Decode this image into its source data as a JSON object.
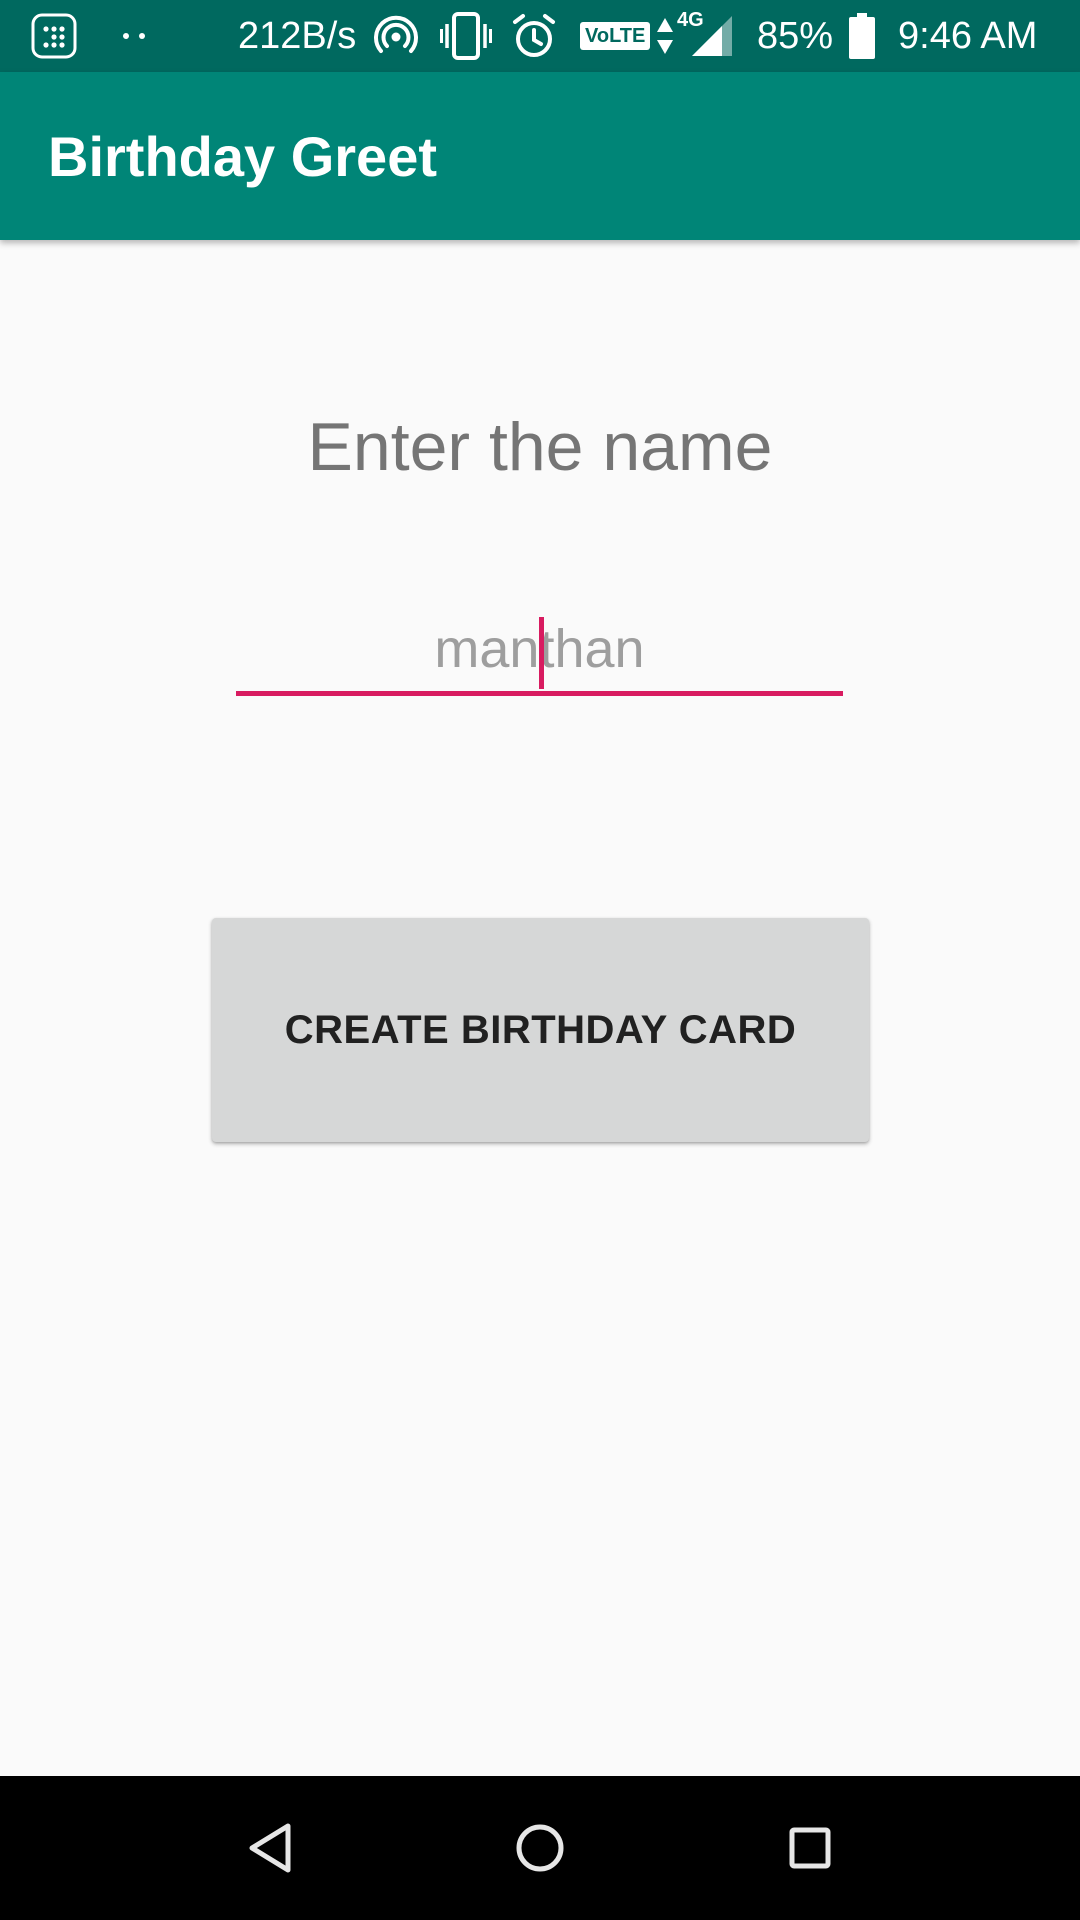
{
  "status_bar": {
    "data_rate": "212B/s",
    "network_label": "VoLTE",
    "network_type": "4G",
    "battery_percent": "85%",
    "time": "9:46 AM",
    "icons": [
      "keypad-notification-icon",
      "more-notifications-dots-icon",
      "hotspot-icon",
      "vibrate-icon",
      "alarm-icon",
      "volte-icon",
      "signal-icon",
      "battery-icon"
    ]
  },
  "app_bar": {
    "title": "Birthday Greet"
  },
  "main": {
    "prompt": "Enter the name",
    "name_input_value": "manthan",
    "create_button_label": "CREATE BIRTHDAY CARD"
  },
  "nav_bar": {
    "icons": [
      "back-icon",
      "home-icon",
      "recents-icon"
    ]
  },
  "colors": {
    "status_bar": "#00695f",
    "app_bar": "#008577",
    "accent": "#d81b60",
    "background": "#fafafa",
    "button": "#d6d7d7"
  }
}
